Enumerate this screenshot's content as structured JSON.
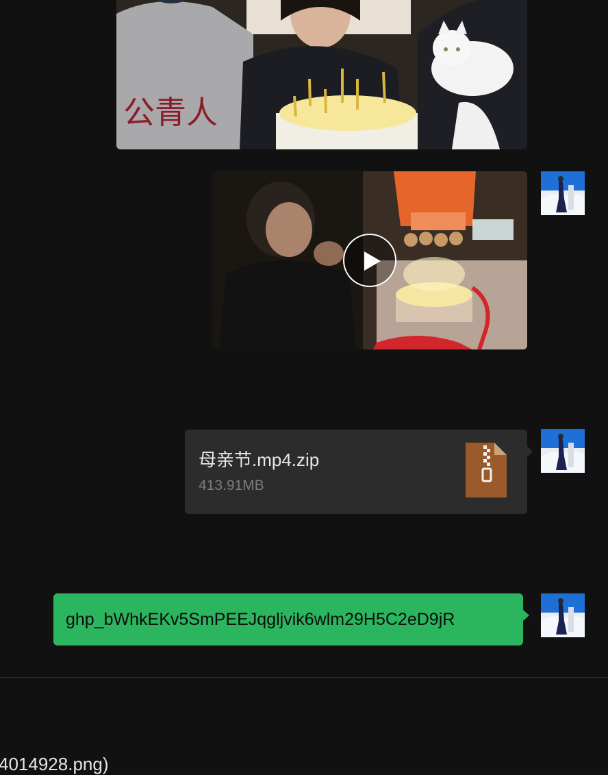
{
  "messages": {
    "photo": {
      "content": "birthday-group-photo"
    },
    "video": {
      "content": "birthday-cake-video",
      "play_icon": "play-icon"
    },
    "file": {
      "name": "母亲节.mp4.zip",
      "size": "413.91MB",
      "icon": "zip-file-icon",
      "icon_color": "#9a5a2a"
    },
    "text": {
      "content": "ghp_bWhkEKv5SmPEEJqgljvik6wlm29H5C2eD9jR",
      "bubble_color": "#2bb55e"
    }
  },
  "input_area": {
    "partial_text": "4014928.png)"
  },
  "colors": {
    "background": "#111111",
    "file_card": "#2c2c2c"
  }
}
